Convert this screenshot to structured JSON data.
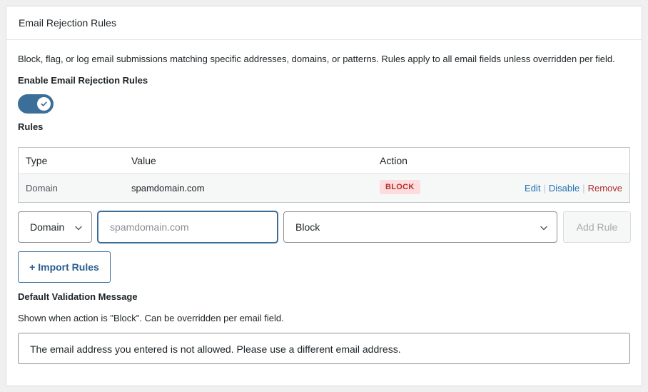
{
  "panel": {
    "title": "Email Rejection Rules",
    "description": "Block, flag, or log email submissions matching specific addresses, domains, or patterns. Rules apply to all email fields unless overridden per field."
  },
  "enable": {
    "label": "Enable Email Rejection Rules",
    "enabled": true
  },
  "rules": {
    "label": "Rules",
    "columns": [
      "Type",
      "Value",
      "Action"
    ],
    "rows": [
      {
        "type": "Domain",
        "value": "spamdomain.com",
        "action": "BLOCK",
        "actions": {
          "edit": "Edit",
          "disable": "Disable",
          "remove": "Remove"
        },
        "separator": "|"
      }
    ]
  },
  "add_form": {
    "type_select": "Domain",
    "value_placeholder": "spamdomain.com",
    "action_select": "Block",
    "add_button": "Add Rule"
  },
  "import_button": "+ Import Rules",
  "default_message": {
    "label": "Default Validation Message",
    "help": "Shown when action is \"Block\". Can be overridden per email field.",
    "value": "The email address you entered is not allowed. Please use a different email address."
  },
  "colors": {
    "accent": "#3b6e98",
    "badge_bg": "#fcdcdc",
    "badge_text": "#b32d2e",
    "link": "#2271b1",
    "remove": "#b32d2e"
  },
  "icons": {
    "toggle": "check-icon",
    "select": "chevron-down-icon"
  }
}
